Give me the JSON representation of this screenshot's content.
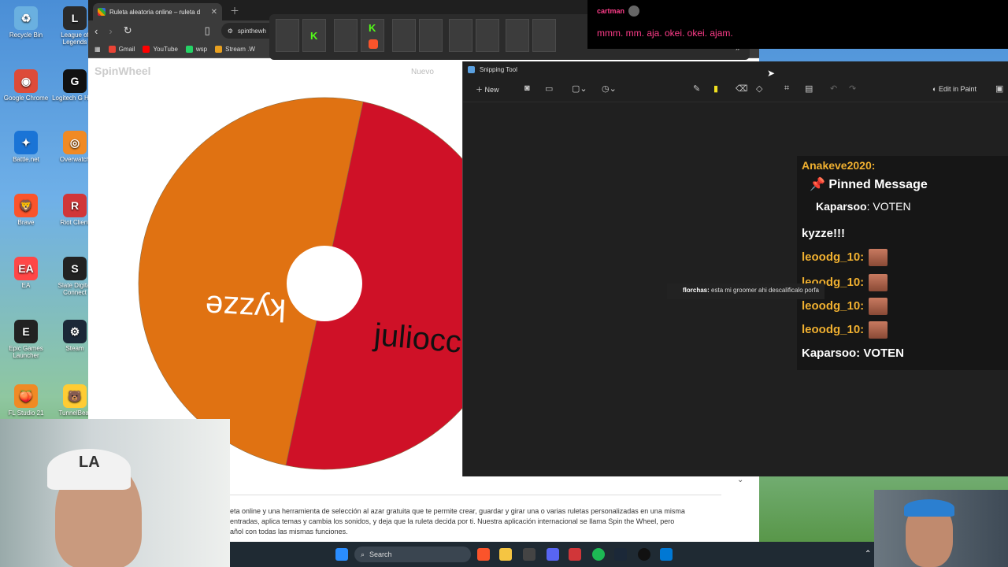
{
  "desktop": {
    "icons": [
      {
        "label": "Recycle Bin",
        "color": "#6ab0e0",
        "glyph": "♻"
      },
      {
        "label": "League of Legends",
        "color": "#2a2a2a",
        "glyph": "L"
      },
      {
        "label": "Google Chrome",
        "color": "#dd4b39",
        "glyph": "◉"
      },
      {
        "label": "Logitech G HUB",
        "color": "#111",
        "glyph": "G"
      },
      {
        "label": "Battle.net",
        "color": "#1a74d6",
        "glyph": "✦"
      },
      {
        "label": "Overwatch",
        "color": "#f08a24",
        "glyph": "◎"
      },
      {
        "label": "Brave",
        "color": "#fb542b",
        "glyph": "🦁"
      },
      {
        "label": "Riot Client",
        "color": "#d13639",
        "glyph": "R"
      },
      {
        "label": "EA",
        "color": "#ff4747",
        "glyph": "EA"
      },
      {
        "label": "Slate Digital Connect",
        "color": "#222",
        "glyph": "S"
      },
      {
        "label": "Epic Games Launcher",
        "color": "#222",
        "glyph": "E"
      },
      {
        "label": "Steam",
        "color": "#1b2838",
        "glyph": "⚙"
      },
      {
        "label": "FL Studio 21",
        "color": "#f08a24",
        "glyph": "🍑"
      },
      {
        "label": "TunnelBear",
        "color": "#ffcc33",
        "glyph": "🐻"
      }
    ]
  },
  "browser": {
    "tab_title": "Ruleta aleatoria online – ruleta d",
    "url": "spinthewh",
    "bookmarks": [
      {
        "label": "Gmail",
        "color": "#ea4335"
      },
      {
        "label": "YouTube",
        "color": "#ff0000"
      },
      {
        "label": "wsp",
        "color": "#25d366"
      },
      {
        "label": "Stream .W",
        "color": "#e8a020"
      }
    ],
    "logo": "SpinWheel",
    "nav_new": "Nuevo",
    "wheel": {
      "segments": [
        {
          "label": "kyzze",
          "color": "#cf1127"
        },
        {
          "label": "juliocc",
          "color": "#e07212"
        }
      ]
    },
    "description": [
      "eta online y una herramienta de selección al azar gratuita que te permite crear, guardar y girar una o varias ruletas personalizadas en una misma",
      "entradas, aplica temas y cambia los sonidos, y deja que la ruleta decida por ti. Nuestra aplicación internacional se llama Spin the Wheel, pero",
      "añol con todas las mismas funciones."
    ]
  },
  "top_chat": {
    "user": "cartman",
    "message": "mmm. mm. aja. okei. okei. ajam."
  },
  "snipping_tool": {
    "title": "Snipping Tool",
    "new_label": "New",
    "edit_in_paint": "Edit in Paint"
  },
  "stream_chat": {
    "header_user": "Anakeve2020:",
    "pinned_title": "Pinned Message",
    "pinned_user": "Kaparsoo",
    "pinned_text": ": VOTEN",
    "lines": [
      {
        "user": "kyzze!!!",
        "color": "#ffffff",
        "face": false
      },
      {
        "user": "leoodg_10:",
        "color": "#f0b030",
        "face": true
      },
      {
        "user": "leoodg_10:",
        "color": "#f0b030",
        "face": true
      },
      {
        "user": "leoodg_10:",
        "color": "#f0b030",
        "face": true
      },
      {
        "user": "leoodg_10:",
        "color": "#f0b030",
        "face": true
      },
      {
        "user": "Kaparsoo: VOTEN",
        "color": "#ffffff",
        "face": false
      }
    ]
  },
  "overlay_msg": {
    "user": "florchas:",
    "text": "esta mi groomer ahi descalificalo porfa"
  },
  "taskbar": {
    "search_label": "Search"
  }
}
